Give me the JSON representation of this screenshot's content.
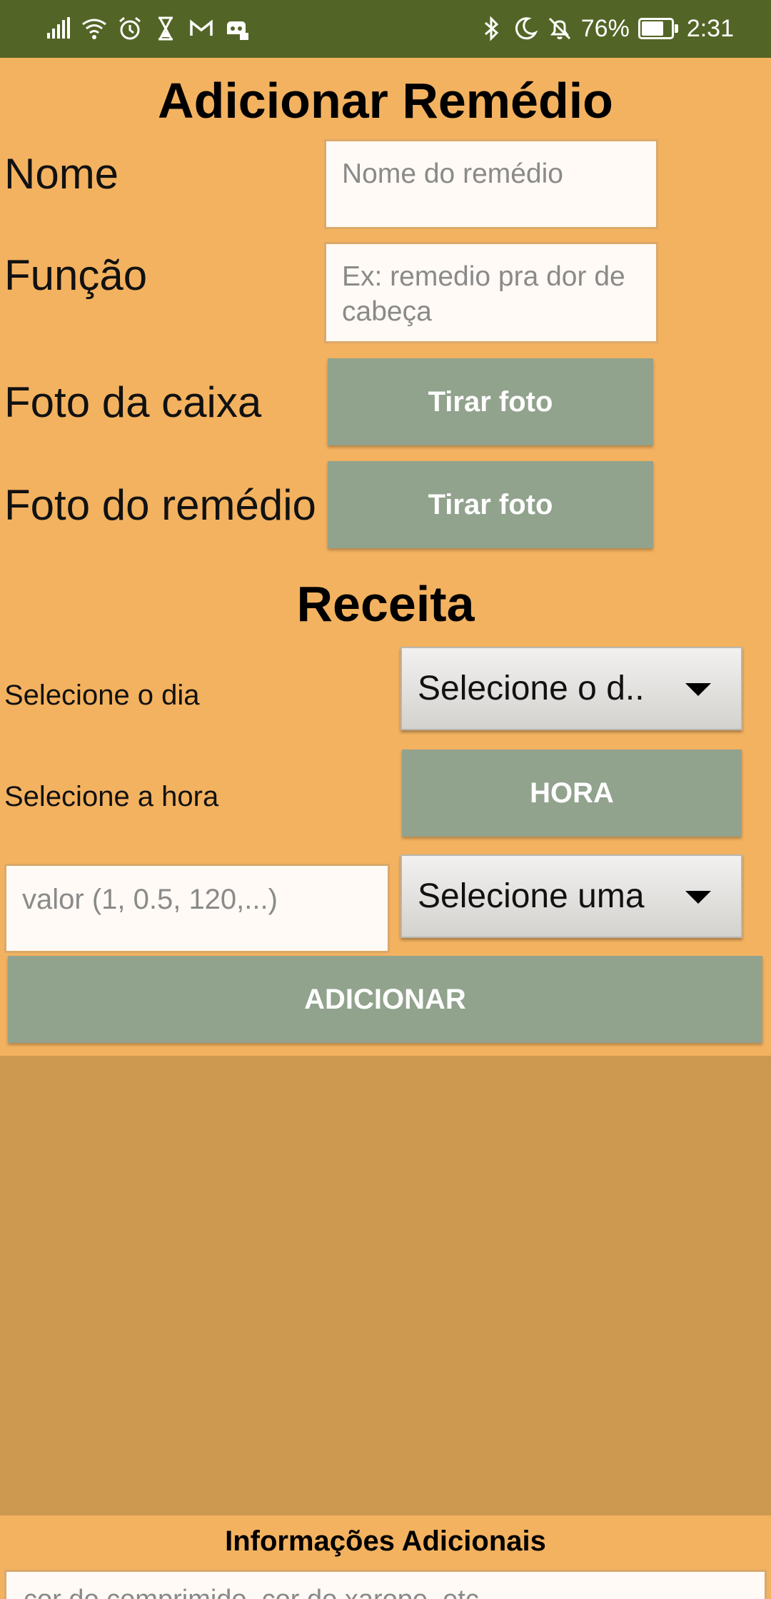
{
  "status_bar": {
    "icons_left": [
      "signal-icon",
      "wifi-icon",
      "alarm-icon",
      "hourglass-icon",
      "gmail-icon",
      "app-notification-icon"
    ],
    "icons_right": [
      "bluetooth-icon",
      "moon-icon",
      "bell-off-icon"
    ],
    "battery_percent": "76%",
    "time": "2:31",
    "battery_level": 0.76
  },
  "page": {
    "title": "Adicionar Remédio"
  },
  "form": {
    "name_label": "Nome",
    "name_placeholder": "Nome do remédio",
    "function_label": "Função",
    "function_placeholder": "Ex: remedio pra dor de cabeça",
    "box_photo_label": "Foto da caixa",
    "box_photo_button": "Tirar foto",
    "med_photo_label": "Foto do remédio",
    "med_photo_button": "Tirar foto"
  },
  "receita": {
    "title": "Receita",
    "day_label": "Selecione o dia",
    "day_dropdown_value": "Selecione o d..",
    "hour_label": "Selecione a hora",
    "hour_button": "HORA",
    "value_placeholder": "valor (1, 0.5, 120,...)",
    "unit_dropdown_value": "Selecione uma",
    "add_button": "ADICIONAR"
  },
  "additional": {
    "title": "Informações Adicionais",
    "placeholder": "cor do comprimido, cor do xarope, etc"
  },
  "colors": {
    "status_bar": "#536526",
    "background": "#f3b260",
    "lower_background": "#cd984f",
    "button_green": "#91a28d"
  }
}
